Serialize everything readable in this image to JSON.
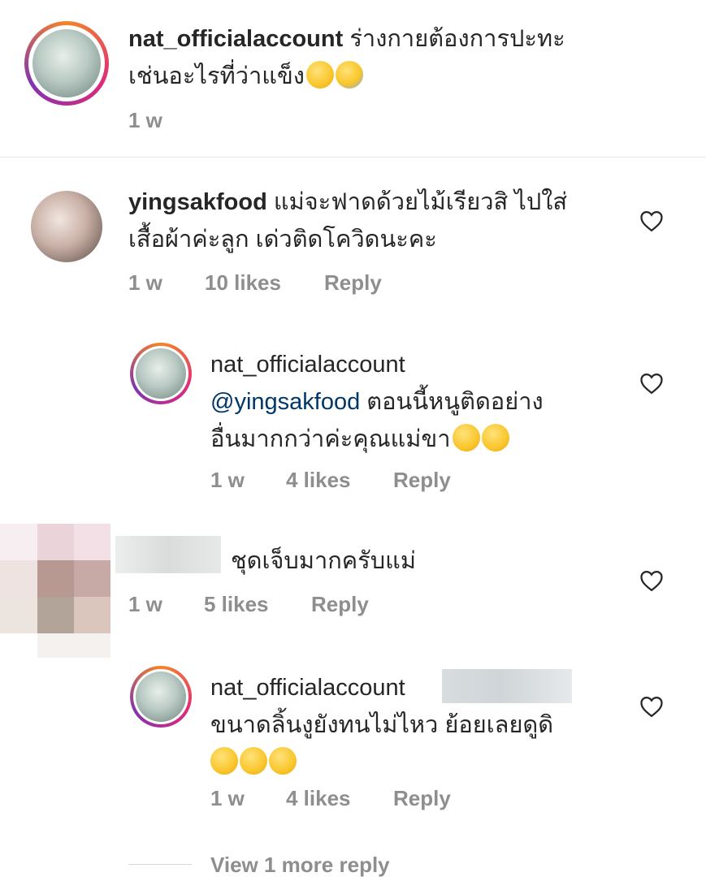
{
  "caption": {
    "username": "nat_officialaccount",
    "text_line1": "ร่างกายต้องการปะทะ",
    "text_line2": "เช่นอะไรที่ว่าแข็ง",
    "emojis": [
      "partying-face",
      "fearful-face"
    ],
    "time": "1 w"
  },
  "comments": [
    {
      "username": "yingsakfood",
      "text_line1": "แม่จะฟาดด้วยไม้เรียวสิ ไปใส่",
      "text_line2": "เสื้อผ้าค่ะลูก เด่วติดโควิดนะคะ",
      "time": "1 w",
      "likes": "10 likes",
      "reply": "Reply"
    },
    {
      "username": "nat_officialaccount",
      "mention": "@yingsakfood",
      "text_line1_rest": " ตอนนี้หนูติดอย่าง",
      "text_line2": "อื่นมากกว่าค่ะคุณแม่ขา",
      "emojis": [
        "grinning-sweat-face",
        "partying-face"
      ],
      "time": "1 w",
      "likes": "4 likes",
      "reply": "Reply"
    },
    {
      "username": "",
      "text_line1": "ชุดเจ็บมากครับแม่",
      "time": "1 w",
      "likes": "5 likes",
      "reply": "Reply"
    },
    {
      "username": "nat_officialaccount",
      "text_line1": "ขนาดลิ้นงูยังทนไม่ไหว ย้อยเลยดูดิ",
      "emojis": [
        "joy-face",
        "joy-face",
        "joy-face"
      ],
      "time": "1 w",
      "likes": "4 likes",
      "reply": "Reply"
    }
  ],
  "view_more": "View 1 more reply",
  "icons": {
    "like": "heart-outline-icon"
  }
}
